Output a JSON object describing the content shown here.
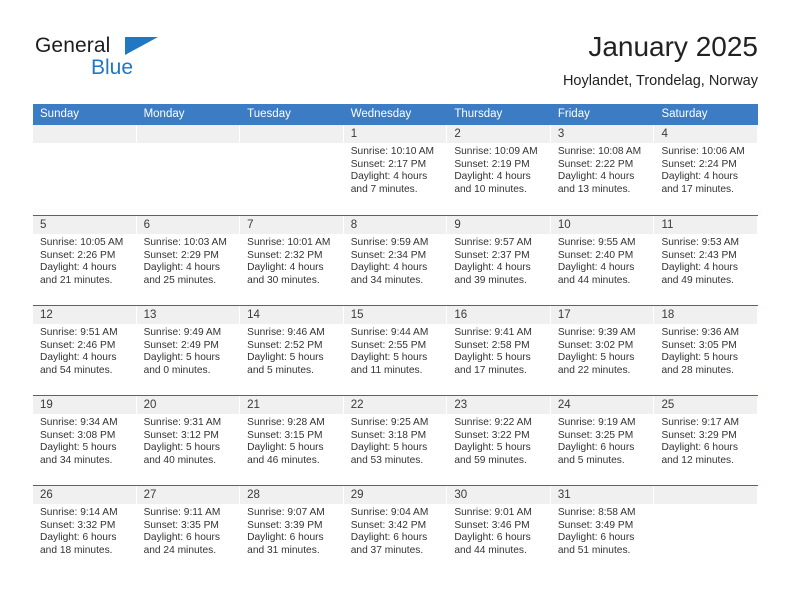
{
  "brand": {
    "name_part1": "General",
    "name_part2": "Blue",
    "accent_color": "#1f78c1"
  },
  "header": {
    "title": "January 2025",
    "subtitle": "Hoylandet, Trondelag, Norway"
  },
  "theme": {
    "header_bar_color": "#3b7cc4",
    "row_rule_color": "#2e6daf",
    "day_band_color": "#f0f0f0"
  },
  "weekdays": [
    "Sunday",
    "Monday",
    "Tuesday",
    "Wednesday",
    "Thursday",
    "Friday",
    "Saturday"
  ],
  "weeks": [
    [
      {
        "day": "",
        "lines": []
      },
      {
        "day": "",
        "lines": []
      },
      {
        "day": "",
        "lines": []
      },
      {
        "day": "1",
        "lines": [
          "Sunrise: 10:10 AM",
          "Sunset: 2:17 PM",
          "Daylight: 4 hours",
          "and 7 minutes."
        ]
      },
      {
        "day": "2",
        "lines": [
          "Sunrise: 10:09 AM",
          "Sunset: 2:19 PM",
          "Daylight: 4 hours",
          "and 10 minutes."
        ]
      },
      {
        "day": "3",
        "lines": [
          "Sunrise: 10:08 AM",
          "Sunset: 2:22 PM",
          "Daylight: 4 hours",
          "and 13 minutes."
        ]
      },
      {
        "day": "4",
        "lines": [
          "Sunrise: 10:06 AM",
          "Sunset: 2:24 PM",
          "Daylight: 4 hours",
          "and 17 minutes."
        ]
      }
    ],
    [
      {
        "day": "5",
        "lines": [
          "Sunrise: 10:05 AM",
          "Sunset: 2:26 PM",
          "Daylight: 4 hours",
          "and 21 minutes."
        ]
      },
      {
        "day": "6",
        "lines": [
          "Sunrise: 10:03 AM",
          "Sunset: 2:29 PM",
          "Daylight: 4 hours",
          "and 25 minutes."
        ]
      },
      {
        "day": "7",
        "lines": [
          "Sunrise: 10:01 AM",
          "Sunset: 2:32 PM",
          "Daylight: 4 hours",
          "and 30 minutes."
        ]
      },
      {
        "day": "8",
        "lines": [
          "Sunrise: 9:59 AM",
          "Sunset: 2:34 PM",
          "Daylight: 4 hours",
          "and 34 minutes."
        ]
      },
      {
        "day": "9",
        "lines": [
          "Sunrise: 9:57 AM",
          "Sunset: 2:37 PM",
          "Daylight: 4 hours",
          "and 39 minutes."
        ]
      },
      {
        "day": "10",
        "lines": [
          "Sunrise: 9:55 AM",
          "Sunset: 2:40 PM",
          "Daylight: 4 hours",
          "and 44 minutes."
        ]
      },
      {
        "day": "11",
        "lines": [
          "Sunrise: 9:53 AM",
          "Sunset: 2:43 PM",
          "Daylight: 4 hours",
          "and 49 minutes."
        ]
      }
    ],
    [
      {
        "day": "12",
        "lines": [
          "Sunrise: 9:51 AM",
          "Sunset: 2:46 PM",
          "Daylight: 4 hours",
          "and 54 minutes."
        ]
      },
      {
        "day": "13",
        "lines": [
          "Sunrise: 9:49 AM",
          "Sunset: 2:49 PM",
          "Daylight: 5 hours",
          "and 0 minutes."
        ]
      },
      {
        "day": "14",
        "lines": [
          "Sunrise: 9:46 AM",
          "Sunset: 2:52 PM",
          "Daylight: 5 hours",
          "and 5 minutes."
        ]
      },
      {
        "day": "15",
        "lines": [
          "Sunrise: 9:44 AM",
          "Sunset: 2:55 PM",
          "Daylight: 5 hours",
          "and 11 minutes."
        ]
      },
      {
        "day": "16",
        "lines": [
          "Sunrise: 9:41 AM",
          "Sunset: 2:58 PM",
          "Daylight: 5 hours",
          "and 17 minutes."
        ]
      },
      {
        "day": "17",
        "lines": [
          "Sunrise: 9:39 AM",
          "Sunset: 3:02 PM",
          "Daylight: 5 hours",
          "and 22 minutes."
        ]
      },
      {
        "day": "18",
        "lines": [
          "Sunrise: 9:36 AM",
          "Sunset: 3:05 PM",
          "Daylight: 5 hours",
          "and 28 minutes."
        ]
      }
    ],
    [
      {
        "day": "19",
        "lines": [
          "Sunrise: 9:34 AM",
          "Sunset: 3:08 PM",
          "Daylight: 5 hours",
          "and 34 minutes."
        ]
      },
      {
        "day": "20",
        "lines": [
          "Sunrise: 9:31 AM",
          "Sunset: 3:12 PM",
          "Daylight: 5 hours",
          "and 40 minutes."
        ]
      },
      {
        "day": "21",
        "lines": [
          "Sunrise: 9:28 AM",
          "Sunset: 3:15 PM",
          "Daylight: 5 hours",
          "and 46 minutes."
        ]
      },
      {
        "day": "22",
        "lines": [
          "Sunrise: 9:25 AM",
          "Sunset: 3:18 PM",
          "Daylight: 5 hours",
          "and 53 minutes."
        ]
      },
      {
        "day": "23",
        "lines": [
          "Sunrise: 9:22 AM",
          "Sunset: 3:22 PM",
          "Daylight: 5 hours",
          "and 59 minutes."
        ]
      },
      {
        "day": "24",
        "lines": [
          "Sunrise: 9:19 AM",
          "Sunset: 3:25 PM",
          "Daylight: 6 hours",
          "and 5 minutes."
        ]
      },
      {
        "day": "25",
        "lines": [
          "Sunrise: 9:17 AM",
          "Sunset: 3:29 PM",
          "Daylight: 6 hours",
          "and 12 minutes."
        ]
      }
    ],
    [
      {
        "day": "26",
        "lines": [
          "Sunrise: 9:14 AM",
          "Sunset: 3:32 PM",
          "Daylight: 6 hours",
          "and 18 minutes."
        ]
      },
      {
        "day": "27",
        "lines": [
          "Sunrise: 9:11 AM",
          "Sunset: 3:35 PM",
          "Daylight: 6 hours",
          "and 24 minutes."
        ]
      },
      {
        "day": "28",
        "lines": [
          "Sunrise: 9:07 AM",
          "Sunset: 3:39 PM",
          "Daylight: 6 hours",
          "and 31 minutes."
        ]
      },
      {
        "day": "29",
        "lines": [
          "Sunrise: 9:04 AM",
          "Sunset: 3:42 PM",
          "Daylight: 6 hours",
          "and 37 minutes."
        ]
      },
      {
        "day": "30",
        "lines": [
          "Sunrise: 9:01 AM",
          "Sunset: 3:46 PM",
          "Daylight: 6 hours",
          "and 44 minutes."
        ]
      },
      {
        "day": "31",
        "lines": [
          "Sunrise: 8:58 AM",
          "Sunset: 3:49 PM",
          "Daylight: 6 hours",
          "and 51 minutes."
        ]
      },
      {
        "day": "",
        "lines": []
      }
    ]
  ]
}
